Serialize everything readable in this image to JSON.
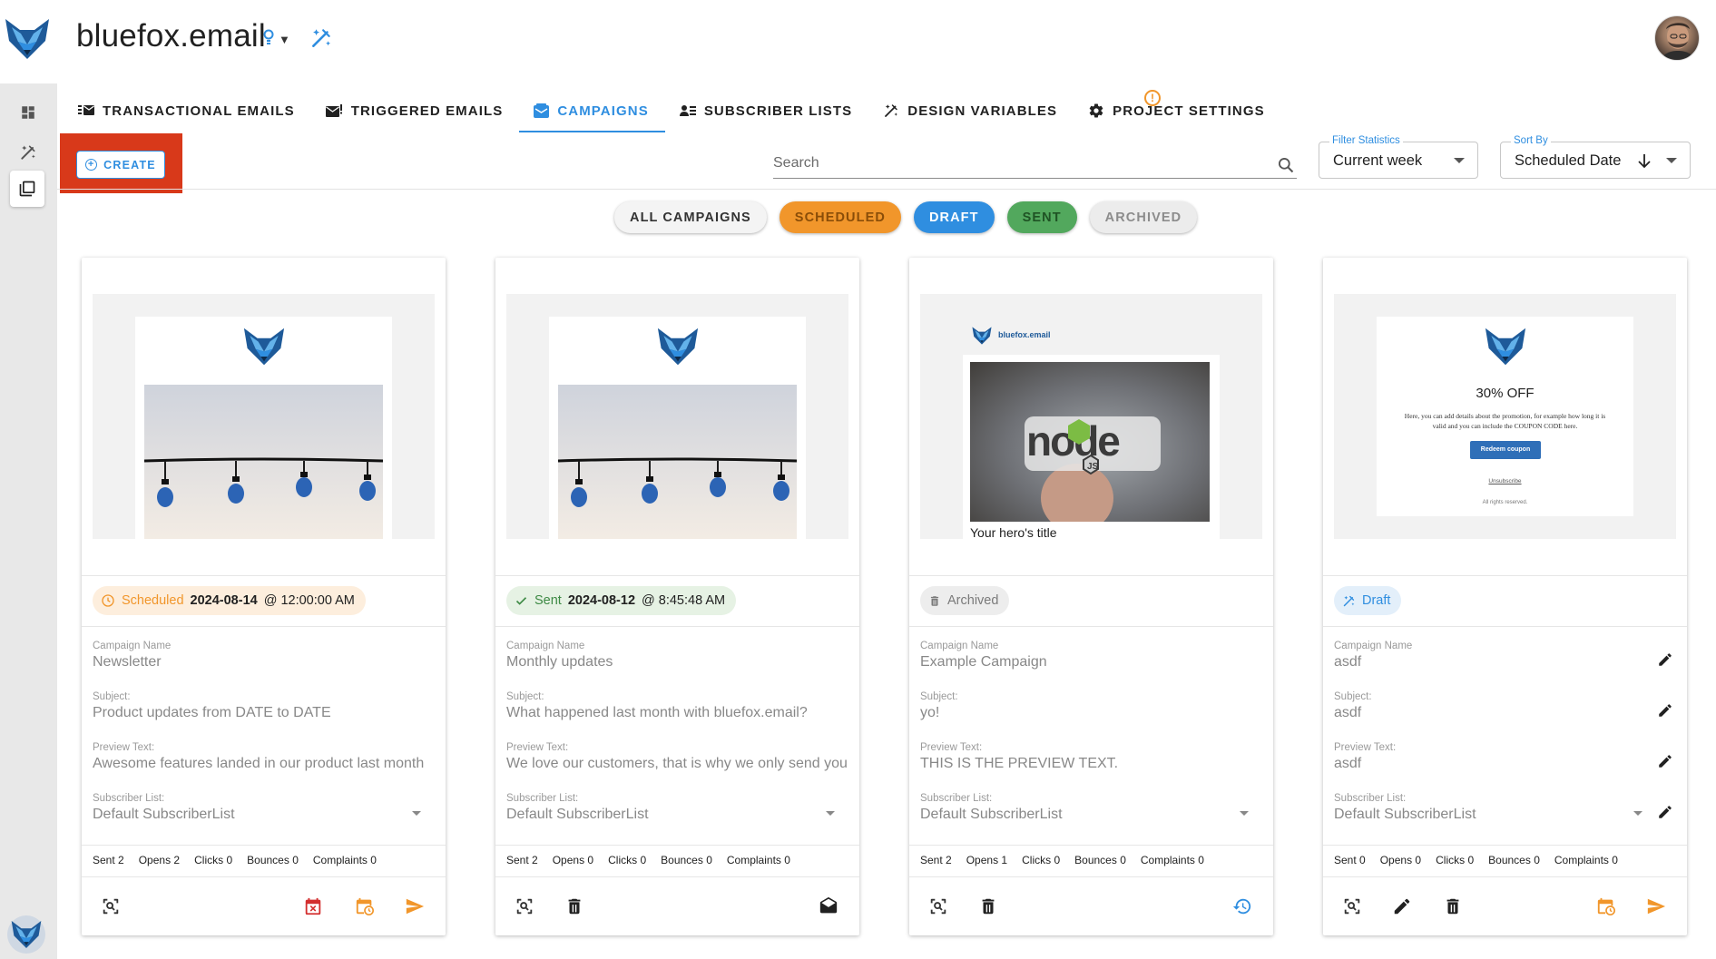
{
  "app": {
    "project_title": "bluefox.email"
  },
  "tabs": [
    {
      "label": "TRANSACTIONAL EMAILS",
      "icon": "transactional-icon"
    },
    {
      "label": "TRIGGERED EMAILS",
      "icon": "triggered-email-icon"
    },
    {
      "label": "CAMPAIGNS",
      "icon": "campaign-icon",
      "active": true
    },
    {
      "label": "SUBSCRIBER LISTS",
      "icon": "subscriber-list-icon"
    },
    {
      "label": "DESIGN VARIABLES",
      "icon": "design-variables-icon"
    },
    {
      "label": "PROJECT SETTINGS",
      "icon": "gear-icon"
    }
  ],
  "warning_badge": "!",
  "toolbar": {
    "create_label": "CREATE",
    "search_placeholder": "Search",
    "filter_label": "Filter Statistics",
    "filter_value": "Current week",
    "sort_label": "Sort By",
    "sort_value": "Scheduled Date"
  },
  "chips": [
    "ALL CAMPAIGNS",
    "SCHEDULED",
    "DRAFT",
    "SENT",
    "ARCHIVED"
  ],
  "field_labels": {
    "name": "Campaign Name",
    "subject": "Subject:",
    "preview": "Preview Text:",
    "list": "Subscriber List:"
  },
  "stat_labels": [
    "Sent",
    "Opens",
    "Clicks",
    "Bounces",
    "Complaints"
  ],
  "preview_texts": {
    "brand": "bluefox.email",
    "node_title": "Your hero's title",
    "promo_heading": "30% OFF",
    "promo_body": "Here, you can add details about the promotion, for example how long it is valid and you can include the COUPON CODE here.",
    "promo_button": "Redeem coupon",
    "promo_unsub": "Unsubscribe",
    "promo_rights": "All rights reserved."
  },
  "campaigns": [
    {
      "status": "Scheduled",
      "date": "2024-08-14",
      "time": "@ 12:00:00 AM",
      "name": "Newsletter",
      "subject": "Product updates from DATE to DATE",
      "preview": "Awesome features landed in our product last month",
      "list": "Default SubscriberList",
      "stats": {
        "sent": "2",
        "opens": "2",
        "clicks": "0",
        "bounces": "0",
        "complaints": "0"
      }
    },
    {
      "status": "Sent",
      "date": "2024-08-12",
      "time": "@ 8:45:48 AM",
      "name": "Monthly updates",
      "subject": "What happened last month with bluefox.email?",
      "preview": "We love our customers, that is why we only send you",
      "list": "Default SubscriberList",
      "stats": {
        "sent": "2",
        "opens": "0",
        "clicks": "0",
        "bounces": "0",
        "complaints": "0"
      }
    },
    {
      "status": "Archived",
      "name": "Example Campaign",
      "subject": "yo!",
      "preview": "THIS IS THE PREVIEW TEXT.",
      "list": "Default SubscriberList",
      "stats": {
        "sent": "2",
        "opens": "1",
        "clicks": "0",
        "bounces": "0",
        "complaints": "0"
      }
    },
    {
      "status": "Draft",
      "name": "asdf",
      "subject": "asdf",
      "preview": "asdf",
      "list": "Default SubscriberList",
      "stats": {
        "sent": "0",
        "opens": "0",
        "clicks": "0",
        "bounces": "0",
        "complaints": "0"
      }
    }
  ],
  "colors": {
    "accent": "#2f8ee0",
    "scheduled": "#f1962b",
    "sent": "#52a85d",
    "danger": "#d32f2f",
    "highlight": "#d8391a"
  }
}
